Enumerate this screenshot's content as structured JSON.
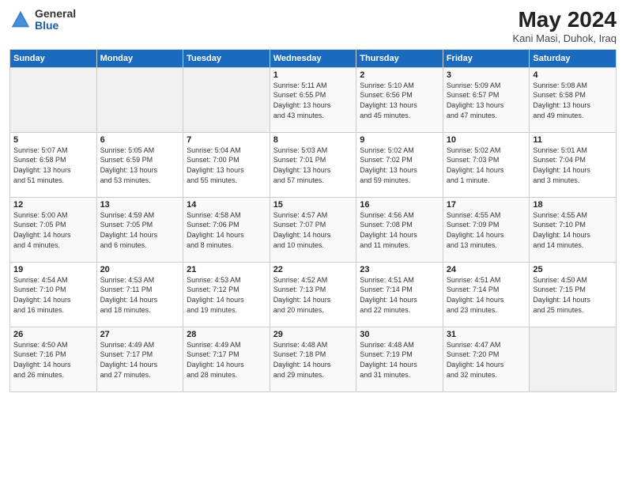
{
  "header": {
    "logo_general": "General",
    "logo_blue": "Blue",
    "month_title": "May 2024",
    "location": "Kani Masi, Duhok, Iraq"
  },
  "weekdays": [
    "Sunday",
    "Monday",
    "Tuesday",
    "Wednesday",
    "Thursday",
    "Friday",
    "Saturday"
  ],
  "weeks": [
    [
      {
        "day": "",
        "info": ""
      },
      {
        "day": "",
        "info": ""
      },
      {
        "day": "",
        "info": ""
      },
      {
        "day": "1",
        "info": "Sunrise: 5:11 AM\nSunset: 6:55 PM\nDaylight: 13 hours\nand 43 minutes."
      },
      {
        "day": "2",
        "info": "Sunrise: 5:10 AM\nSunset: 6:56 PM\nDaylight: 13 hours\nand 45 minutes."
      },
      {
        "day": "3",
        "info": "Sunrise: 5:09 AM\nSunset: 6:57 PM\nDaylight: 13 hours\nand 47 minutes."
      },
      {
        "day": "4",
        "info": "Sunrise: 5:08 AM\nSunset: 6:58 PM\nDaylight: 13 hours\nand 49 minutes."
      }
    ],
    [
      {
        "day": "5",
        "info": "Sunrise: 5:07 AM\nSunset: 6:58 PM\nDaylight: 13 hours\nand 51 minutes."
      },
      {
        "day": "6",
        "info": "Sunrise: 5:05 AM\nSunset: 6:59 PM\nDaylight: 13 hours\nand 53 minutes."
      },
      {
        "day": "7",
        "info": "Sunrise: 5:04 AM\nSunset: 7:00 PM\nDaylight: 13 hours\nand 55 minutes."
      },
      {
        "day": "8",
        "info": "Sunrise: 5:03 AM\nSunset: 7:01 PM\nDaylight: 13 hours\nand 57 minutes."
      },
      {
        "day": "9",
        "info": "Sunrise: 5:02 AM\nSunset: 7:02 PM\nDaylight: 13 hours\nand 59 minutes."
      },
      {
        "day": "10",
        "info": "Sunrise: 5:02 AM\nSunset: 7:03 PM\nDaylight: 14 hours\nand 1 minute."
      },
      {
        "day": "11",
        "info": "Sunrise: 5:01 AM\nSunset: 7:04 PM\nDaylight: 14 hours\nand 3 minutes."
      }
    ],
    [
      {
        "day": "12",
        "info": "Sunrise: 5:00 AM\nSunset: 7:05 PM\nDaylight: 14 hours\nand 4 minutes."
      },
      {
        "day": "13",
        "info": "Sunrise: 4:59 AM\nSunset: 7:05 PM\nDaylight: 14 hours\nand 6 minutes."
      },
      {
        "day": "14",
        "info": "Sunrise: 4:58 AM\nSunset: 7:06 PM\nDaylight: 14 hours\nand 8 minutes."
      },
      {
        "day": "15",
        "info": "Sunrise: 4:57 AM\nSunset: 7:07 PM\nDaylight: 14 hours\nand 10 minutes."
      },
      {
        "day": "16",
        "info": "Sunrise: 4:56 AM\nSunset: 7:08 PM\nDaylight: 14 hours\nand 11 minutes."
      },
      {
        "day": "17",
        "info": "Sunrise: 4:55 AM\nSunset: 7:09 PM\nDaylight: 14 hours\nand 13 minutes."
      },
      {
        "day": "18",
        "info": "Sunrise: 4:55 AM\nSunset: 7:10 PM\nDaylight: 14 hours\nand 14 minutes."
      }
    ],
    [
      {
        "day": "19",
        "info": "Sunrise: 4:54 AM\nSunset: 7:10 PM\nDaylight: 14 hours\nand 16 minutes."
      },
      {
        "day": "20",
        "info": "Sunrise: 4:53 AM\nSunset: 7:11 PM\nDaylight: 14 hours\nand 18 minutes."
      },
      {
        "day": "21",
        "info": "Sunrise: 4:53 AM\nSunset: 7:12 PM\nDaylight: 14 hours\nand 19 minutes."
      },
      {
        "day": "22",
        "info": "Sunrise: 4:52 AM\nSunset: 7:13 PM\nDaylight: 14 hours\nand 20 minutes."
      },
      {
        "day": "23",
        "info": "Sunrise: 4:51 AM\nSunset: 7:14 PM\nDaylight: 14 hours\nand 22 minutes."
      },
      {
        "day": "24",
        "info": "Sunrise: 4:51 AM\nSunset: 7:14 PM\nDaylight: 14 hours\nand 23 minutes."
      },
      {
        "day": "25",
        "info": "Sunrise: 4:50 AM\nSunset: 7:15 PM\nDaylight: 14 hours\nand 25 minutes."
      }
    ],
    [
      {
        "day": "26",
        "info": "Sunrise: 4:50 AM\nSunset: 7:16 PM\nDaylight: 14 hours\nand 26 minutes."
      },
      {
        "day": "27",
        "info": "Sunrise: 4:49 AM\nSunset: 7:17 PM\nDaylight: 14 hours\nand 27 minutes."
      },
      {
        "day": "28",
        "info": "Sunrise: 4:49 AM\nSunset: 7:17 PM\nDaylight: 14 hours\nand 28 minutes."
      },
      {
        "day": "29",
        "info": "Sunrise: 4:48 AM\nSunset: 7:18 PM\nDaylight: 14 hours\nand 29 minutes."
      },
      {
        "day": "30",
        "info": "Sunrise: 4:48 AM\nSunset: 7:19 PM\nDaylight: 14 hours\nand 31 minutes."
      },
      {
        "day": "31",
        "info": "Sunrise: 4:47 AM\nSunset: 7:20 PM\nDaylight: 14 hours\nand 32 minutes."
      },
      {
        "day": "",
        "info": ""
      }
    ]
  ]
}
